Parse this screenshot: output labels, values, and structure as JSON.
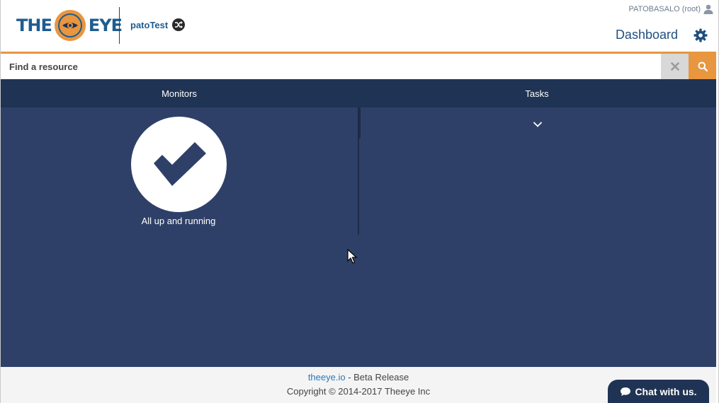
{
  "header": {
    "logo_left": "THE",
    "logo_right": "EYE",
    "org_name": "patoTest",
    "user_label": "PATOBASALO (root)",
    "dashboard_label": "Dashboard"
  },
  "search": {
    "placeholder": "Find a resource",
    "value": ""
  },
  "panels": {
    "monitors_label": "Monitors",
    "tasks_label": "Tasks",
    "status_text": "All up and running"
  },
  "footer": {
    "link_text": "theeye.io",
    "release_suffix": " - Beta Release",
    "copyright": "Copyright © 2014-2017 Theeye Inc"
  },
  "chat": {
    "label": "Chat with us."
  },
  "colors": {
    "accent_orange": "#e8963f",
    "navy_dark": "#1f3354",
    "navy_panel": "#2f4068",
    "brand_blue": "#1f5c8f"
  },
  "icons": [
    "eye-logo-icon",
    "shuffle-icon",
    "user-icon",
    "gear-icon",
    "close-icon",
    "search-icon",
    "check-icon",
    "chevron-down-icon",
    "chat-bubble-icon",
    "mouse-cursor-icon"
  ]
}
